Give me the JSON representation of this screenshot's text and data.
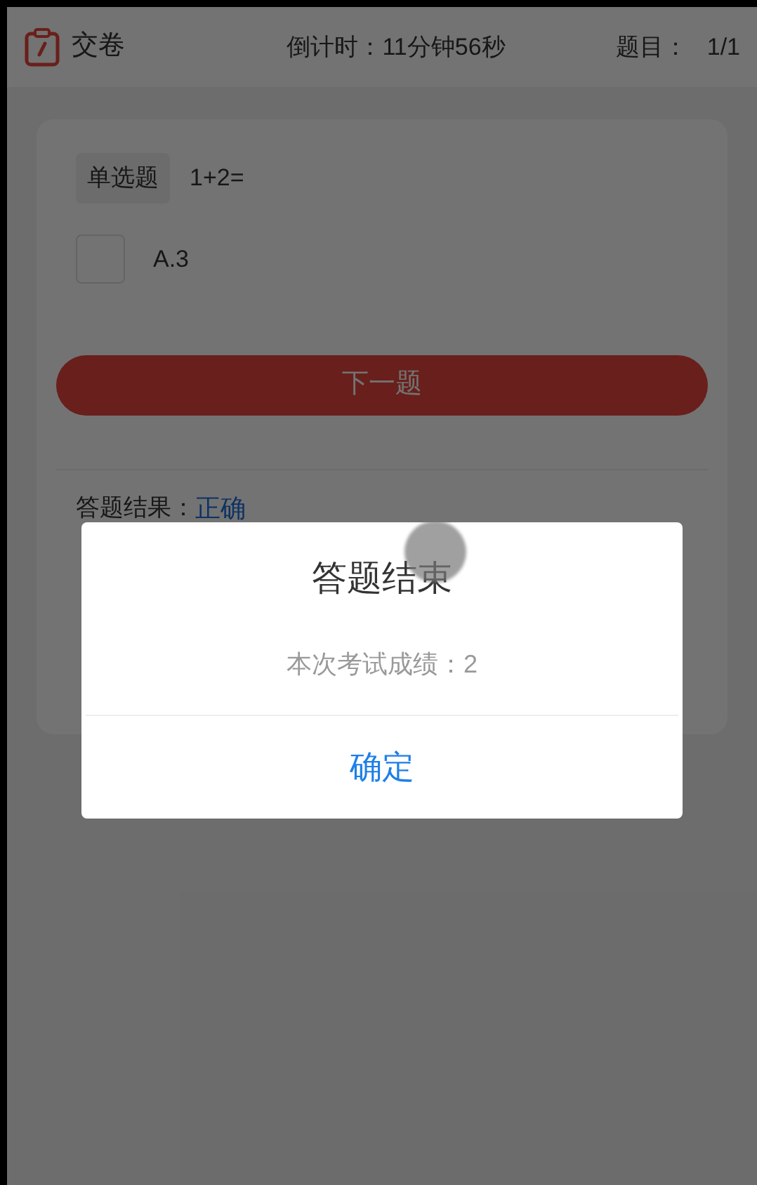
{
  "header": {
    "submit_label": "交卷",
    "countdown": "倒计时：11分钟56秒",
    "counter_label": "题目：",
    "counter_value": "1/1"
  },
  "question": {
    "type_tag": "单选题",
    "text": "1+2=",
    "options": [
      {
        "label": "A.3",
        "checked": false
      }
    ]
  },
  "next_button": "下一题",
  "result": {
    "label": "答题结果：",
    "value": "正确"
  },
  "dialog": {
    "title": "答题结束",
    "message": "本次考试成绩：2",
    "confirm": "确定"
  }
}
